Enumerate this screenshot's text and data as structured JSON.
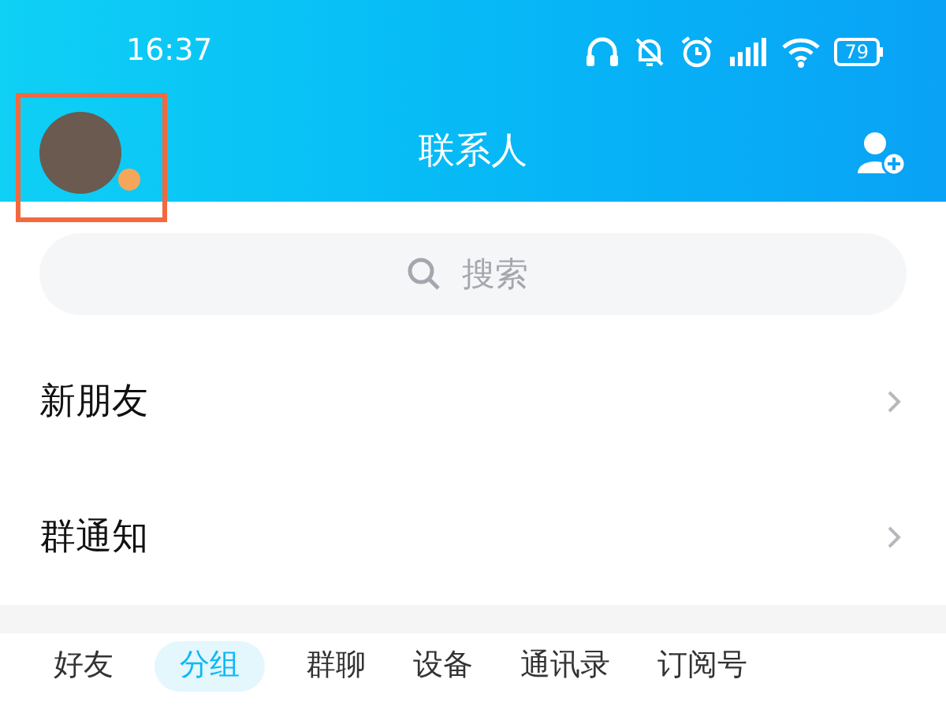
{
  "status_bar": {
    "time": "16:37",
    "battery": "79"
  },
  "header": {
    "title": "联系人",
    "avatar": {
      "highlighted": true
    }
  },
  "search": {
    "placeholder": "搜索"
  },
  "entries": [
    {
      "label": "新朋友"
    },
    {
      "label": "群通知"
    }
  ],
  "tabs": [
    {
      "label": "好友",
      "selected": false
    },
    {
      "label": "分组",
      "selected": true
    },
    {
      "label": "群聊",
      "selected": false
    },
    {
      "label": "设备",
      "selected": false
    },
    {
      "label": "通讯录",
      "selected": false
    },
    {
      "label": "订阅号",
      "selected": false
    }
  ]
}
